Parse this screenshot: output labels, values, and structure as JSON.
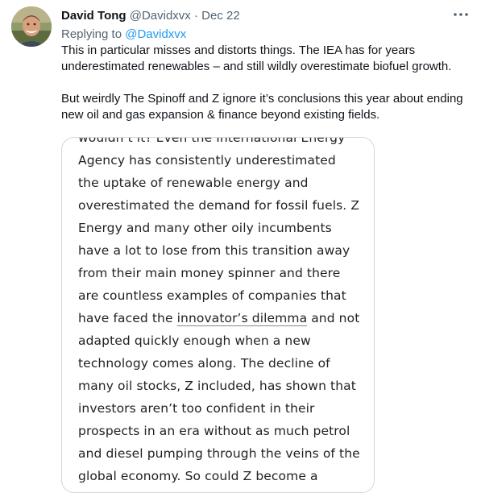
{
  "tweet": {
    "author_name": "David Tong",
    "author_handle": "@Davidxvx",
    "separator": "·",
    "date": "Dec 22",
    "more_icon": "more-horizontal-icon",
    "replying_prefix": "Replying to",
    "replying_handle": "@Davidxvx",
    "paragraph_1": "This in particular misses and distorts things. The IEA has for years\nunderestimated renewables – and still wildly overestimate biofuel growth.",
    "paragraph_2": "But weirdly The Spinoff and Z ignore it’s conclusions this year about ending\nnew oil and gas expansion & finance beyond existing fields."
  },
  "media": {
    "lines": [
      "wouldn’t it? Even the International Energy",
      "Agency has consistently underestimated",
      "the uptake of renewable energy and",
      "overestimated the demand for fossil fuels. Z",
      "Energy and many other oily incumbents",
      "have a lot to lose from this transition away",
      "from their main money spinner and there",
      "are countless examples of companies that"
    ],
    "line_link_pre": "have faced the ",
    "line_link_text": "innovator’s dilemma",
    "line_link_post": " and not",
    "lines_after": [
      "adapted quickly enough when a new",
      "technology comes along. The decline of",
      "many oil stocks, Z included, has shown that",
      "investors aren’t too confident in their",
      "prospects in an era without as much petrol",
      "and diesel pumping through the veins of the",
      "global economy. So could Z become a"
    ]
  }
}
